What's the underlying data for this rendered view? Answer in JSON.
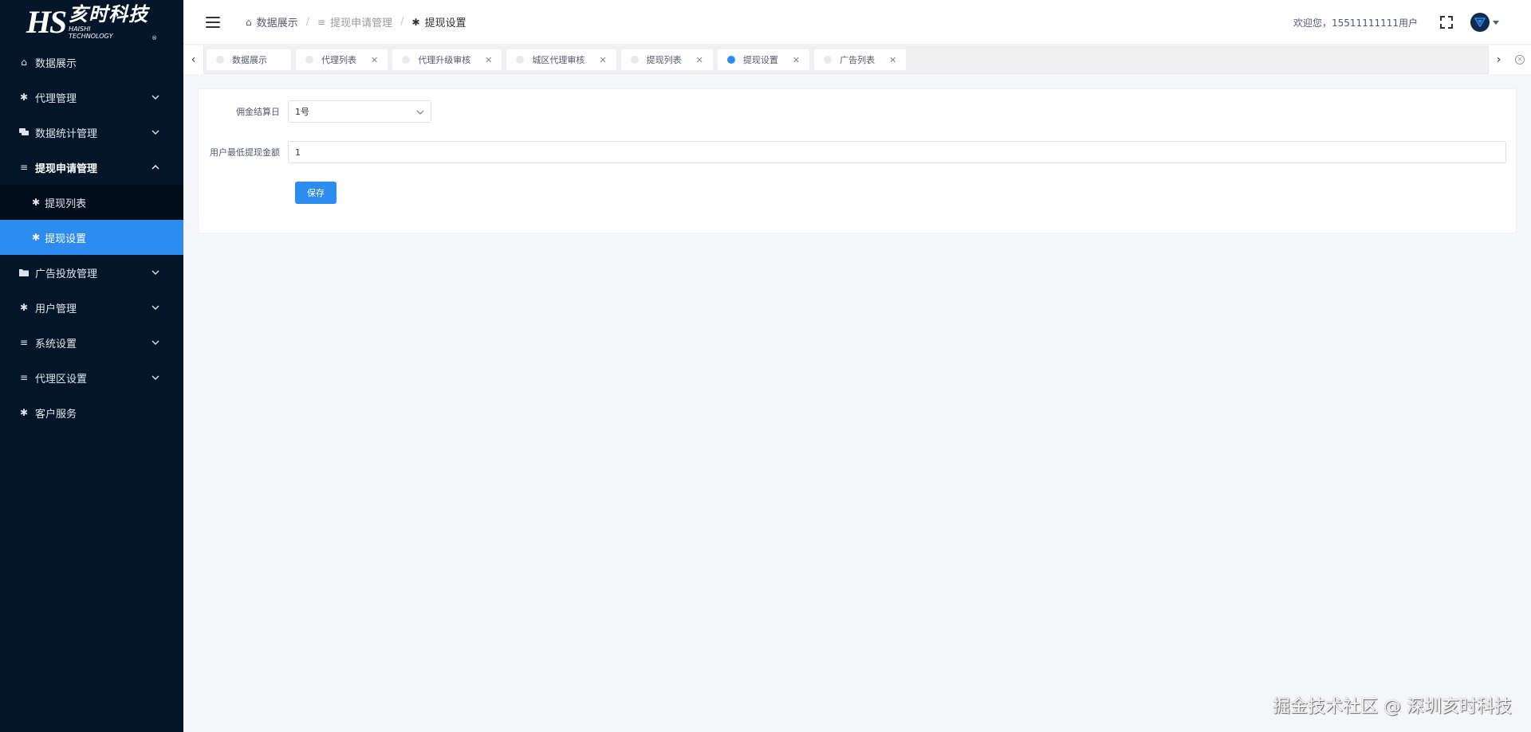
{
  "logo": {
    "mark": "HS",
    "name_cn": "亥时科技",
    "name_en_1": "HAISHI",
    "name_en_2": "TECHNOLOGY",
    "reg": "®"
  },
  "sidebar": {
    "items": [
      {
        "label": "数据展示",
        "icon": "home-icon",
        "chevron": false
      },
      {
        "label": "代理管理",
        "icon": "asterisk-icon",
        "chevron": true
      },
      {
        "label": "数据统计管理",
        "icon": "chat-icon",
        "chevron": true
      },
      {
        "label": "提现申请管理",
        "icon": "list-icon",
        "chevron": true,
        "open": true,
        "children": [
          {
            "label": "提现列表",
            "icon": "asterisk-icon"
          },
          {
            "label": "提现设置",
            "icon": "asterisk-icon",
            "active": true
          }
        ]
      },
      {
        "label": "广告投放管理",
        "icon": "folder-icon",
        "chevron": true
      },
      {
        "label": "用户管理",
        "icon": "asterisk-icon",
        "chevron": true
      },
      {
        "label": "系统设置",
        "icon": "list-icon",
        "chevron": true
      },
      {
        "label": "代理区设置",
        "icon": "list-icon",
        "chevron": true
      },
      {
        "label": "客户服务",
        "icon": "asterisk-icon",
        "chevron": false
      }
    ]
  },
  "breadcrumb": [
    {
      "label": "数据展示",
      "icon": "home-icon"
    },
    {
      "label": "提现申请管理",
      "icon": "list-icon"
    },
    {
      "label": "提现设置",
      "icon": "asterisk-icon"
    }
  ],
  "header": {
    "welcome": "欢迎您，15511111111用户"
  },
  "tabs": [
    {
      "label": "数据展示",
      "closable": false,
      "active": false
    },
    {
      "label": "代理列表",
      "closable": true,
      "active": false
    },
    {
      "label": "代理升级审核",
      "closable": true,
      "active": false
    },
    {
      "label": "城区代理审核",
      "closable": true,
      "active": false
    },
    {
      "label": "提现列表",
      "closable": true,
      "active": false
    },
    {
      "label": "提现设置",
      "closable": true,
      "active": true
    },
    {
      "label": "广告列表",
      "closable": true,
      "active": false
    }
  ],
  "form": {
    "settlement_day_label": "佣金结算日",
    "settlement_day_value": "1号",
    "min_withdraw_label": "用户最低提现金额",
    "min_withdraw_value": "1",
    "save_label": "保存"
  },
  "watermark": "掘金技术社区 @ 深圳亥时科技",
  "colors": {
    "sidebar_bg": "#031528",
    "accent": "#2d8cf0",
    "page_bg": "#f4f6f9"
  }
}
